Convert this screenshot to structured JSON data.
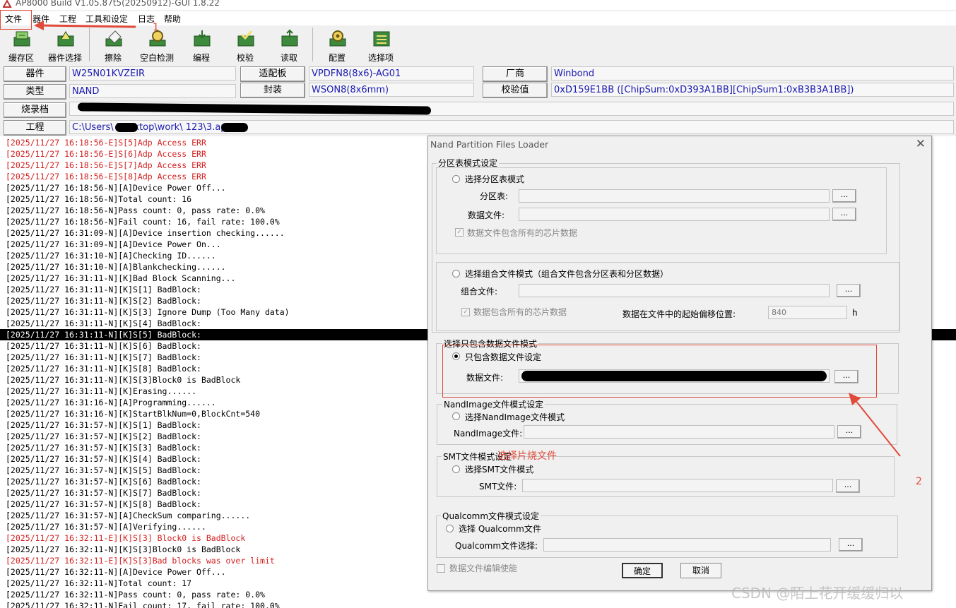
{
  "window": {
    "title": "AP8000 Build V1.05.87t5(20250912)-GUI 1.8.22"
  },
  "menu": [
    "文件",
    "器件",
    "工程",
    "工具和设定",
    "日志",
    "帮助"
  ],
  "toolbar": {
    "buttons": [
      {
        "label": "缓存区",
        "icon": "buffer-icon"
      },
      {
        "label": "器件选择",
        "icon": "device-select-icon"
      },
      {
        "label": "擦除",
        "icon": "erase-icon"
      },
      {
        "label": "空白检测",
        "icon": "blank-check-icon"
      },
      {
        "label": "编程",
        "icon": "program-icon"
      },
      {
        "label": "校验",
        "icon": "verify-icon"
      },
      {
        "label": "读取",
        "icon": "read-icon"
      },
      {
        "label": "配置",
        "icon": "config-icon"
      },
      {
        "label": "选择项",
        "icon": "options-icon"
      }
    ]
  },
  "info": {
    "device_label": "器件",
    "device_value": "W25N01KVZEIR",
    "adapter_label": "适配板",
    "adapter_value": "VPDFN8(8x6)-AG01",
    "vendor_label": "厂商",
    "vendor_value": "Winbond",
    "type_label": "类型",
    "type_value": "NAND",
    "package_label": "封装",
    "package_value": "WSON8(8x6mm)",
    "checksum_label": "校验值",
    "checksum_value": "0xD159E1BB  ([ChipSum:0xD393A1BB][ChipSum1:0xB3B3A1BB])",
    "burnfile_label": "烧录档",
    "burnfile_value": "",
    "project_label": "工程",
    "project_value": "C:\\Users\\      Desktop\\work\\        123\\3.apr"
  },
  "log": [
    {
      "text": "[2025/11/27 16:18:56-E]S[5]Adp Access ERR",
      "kind": "err"
    },
    {
      "text": "[2025/11/27 16:18:56-E]S[6]Adp Access ERR",
      "kind": "err"
    },
    {
      "text": "[2025/11/27 16:18:56-E]S[7]Adp Access ERR",
      "kind": "err"
    },
    {
      "text": "[2025/11/27 16:18:56-E]S[8]Adp Access ERR",
      "kind": "err"
    },
    {
      "text": "[2025/11/27 16:18:56-N][A]Device Power Off...",
      "kind": "n"
    },
    {
      "text": "[2025/11/27 16:18:56-N]Total count: 16",
      "kind": "n"
    },
    {
      "text": "[2025/11/27 16:18:56-N]Pass count: 0, pass rate: 0.0%",
      "kind": "n"
    },
    {
      "text": "[2025/11/27 16:18:56-N]Fail count: 16, fail rate: 100.0%",
      "kind": "n"
    },
    {
      "text": "[2025/11/27 16:31:09-N][A]Device insertion checking......",
      "kind": "n"
    },
    {
      "text": "[2025/11/27 16:31:09-N][A]Device Power On...",
      "kind": "n"
    },
    {
      "text": "[2025/11/27 16:31:10-N][A]Checking ID......",
      "kind": "n"
    },
    {
      "text": "[2025/11/27 16:31:10-N][A]Blankchecking......",
      "kind": "n"
    },
    {
      "text": "[2025/11/27 16:31:11-N][K]Bad Block Scanning...",
      "kind": "n"
    },
    {
      "text": "[2025/11/27 16:31:11-N][K]S[1] BadBlock:",
      "kind": "n"
    },
    {
      "text": "[2025/11/27 16:31:11-N][K]S[2] BadBlock:",
      "kind": "n"
    },
    {
      "text": "[2025/11/27 16:31:11-N][K]S[3] Ignore Dump (Too Many data)",
      "kind": "n"
    },
    {
      "text": "[2025/11/27 16:31:11-N][K]S[4] BadBlock:",
      "kind": "n"
    },
    {
      "text": "[2025/11/27 16:31:11-N][K]S[5] BadBlock:",
      "kind": "sel"
    },
    {
      "text": "[2025/11/27 16:31:11-N][K]S[6] BadBlock:",
      "kind": "n"
    },
    {
      "text": "[2025/11/27 16:31:11-N][K]S[7] BadBlock:",
      "kind": "n"
    },
    {
      "text": "[2025/11/27 16:31:11-N][K]S[8] BadBlock:",
      "kind": "n"
    },
    {
      "text": "[2025/11/27 16:31:11-N][K]S[3]Block0 is BadBlock",
      "kind": "n"
    },
    {
      "text": "[2025/11/27 16:31:11-N][K]Erasing......",
      "kind": "n"
    },
    {
      "text": "[2025/11/27 16:31:16-N][A]Programming......",
      "kind": "n"
    },
    {
      "text": "[2025/11/27 16:31:16-N][K]StartBlkNum=0,BlockCnt=540",
      "kind": "n"
    },
    {
      "text": "[2025/11/27 16:31:57-N][K]S[1] BadBlock:",
      "kind": "n"
    },
    {
      "text": "[2025/11/27 16:31:57-N][K]S[2] BadBlock:",
      "kind": "n"
    },
    {
      "text": "[2025/11/27 16:31:57-N][K]S[3] BadBlock:",
      "kind": "n"
    },
    {
      "text": "[2025/11/27 16:31:57-N][K]S[4] BadBlock:",
      "kind": "n"
    },
    {
      "text": "[2025/11/27 16:31:57-N][K]S[5] BadBlock:",
      "kind": "n"
    },
    {
      "text": "[2025/11/27 16:31:57-N][K]S[6] BadBlock:",
      "kind": "n"
    },
    {
      "text": "[2025/11/27 16:31:57-N][K]S[7] BadBlock:",
      "kind": "n"
    },
    {
      "text": "[2025/11/27 16:31:57-N][K]S[8] BadBlock:",
      "kind": "n"
    },
    {
      "text": "[2025/11/27 16:31:57-N][A]CheckSum comparing......",
      "kind": "n"
    },
    {
      "text": "[2025/11/27 16:31:57-N][A]Verifying......",
      "kind": "n"
    },
    {
      "text": "[2025/11/27 16:32:11-E][K]S[3] Block0 is BadBlock",
      "kind": "err"
    },
    {
      "text": "[2025/11/27 16:32:11-N][K]S[3]Block0 is BadBlock",
      "kind": "n"
    },
    {
      "text": "[2025/11/27 16:32:11-E][K]S[3]Bad blocks was over limit",
      "kind": "err"
    },
    {
      "text": "[2025/11/27 16:32:11-N][A]Device Power Off...",
      "kind": "n"
    },
    {
      "text": "[2025/11/27 16:32:11-N]Total count: 17",
      "kind": "n"
    },
    {
      "text": "[2025/11/27 16:32:11-N]Pass count: 0, pass rate: 0.0%",
      "kind": "n"
    },
    {
      "text": "[2025/11/27 16:32:11-N]Fail count: 17, fail rate: 100.0%",
      "kind": "n"
    }
  ],
  "dialog": {
    "title": "Nand Partition Files Loader",
    "close": "✕",
    "g1": {
      "title": "分区表模式设定",
      "radio": "选择分区表模式",
      "ptable_label": "分区表:",
      "datafile_label": "数据文件:",
      "check": "数据文件包含所有的芯片数据"
    },
    "g2": {
      "radio": "选择组合文件模式（组合文件包含分区表和分区数据）",
      "combo_label": "组合文件:",
      "check": "数据包含所有的芯片数据",
      "offset_label": "数据在文件中的起始偏移位置:",
      "offset_value": "840",
      "offset_unit": "h"
    },
    "g3": {
      "title": "选择只包含数据文件模式",
      "radio": "只包含数据文件设定",
      "datafile_label": "数据文件:"
    },
    "g4": {
      "title": "NandImage文件模式设定",
      "radio": "选择NandImage文件模式",
      "file_label": "NandImage文件:"
    },
    "g5": {
      "title": "SMT文件模式设定",
      "radio": "选择SMT文件模式",
      "file_label": "SMT文件:"
    },
    "g6": {
      "title": "Qualcomm文件模式设定",
      "radio": "选择 Qualcomm文件",
      "file_label": "Qualcomm文件选择:"
    },
    "bottom_check": "数据文件编辑使能",
    "ok": "确定",
    "cancel": "取消",
    "browse": "..."
  },
  "annotations": {
    "num1": "1",
    "num2": "2",
    "note": "选择片烧文件"
  },
  "watermark": "CSDN @陌上花开缓缓归以",
  "colors": {
    "accent_red": "#e04a3a",
    "value_blue": "#1a1ab0",
    "error_red": "#d42020"
  }
}
